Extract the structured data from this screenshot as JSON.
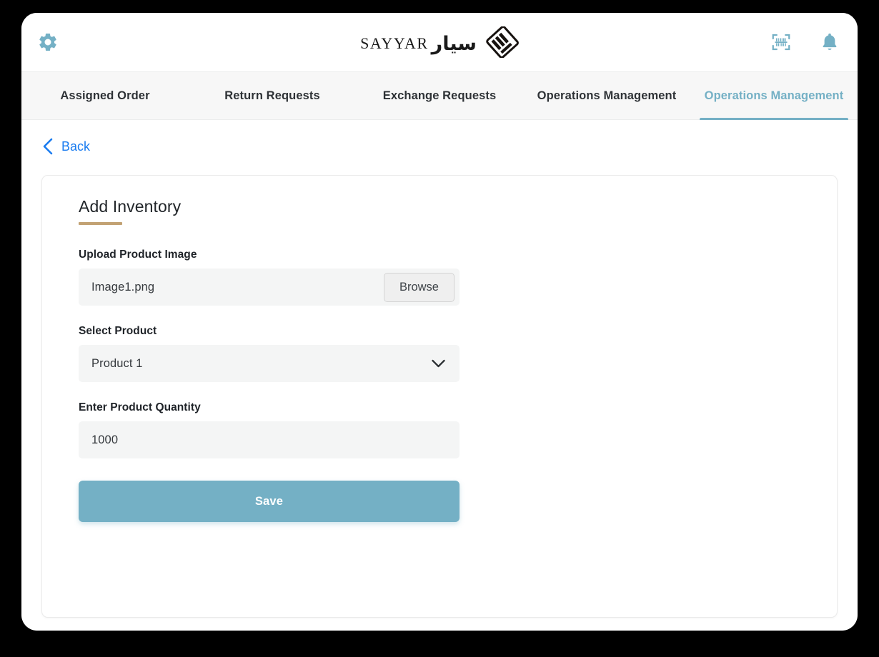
{
  "brand": {
    "latin_name": "SAYYAR",
    "arabic_name": "سيار",
    "logo_icon": "sayyar-diamond-logo"
  },
  "topbar": {
    "gear_icon": "gear-icon",
    "barcode_icon": "barcode-scanner-icon",
    "bell_icon": "notification-bell-icon",
    "accent_color": "#74b0c5"
  },
  "tabs": [
    {
      "label": "Assigned Order",
      "active": false
    },
    {
      "label": "Return Requests",
      "active": false
    },
    {
      "label": "Exchange Requests",
      "active": false
    },
    {
      "label": "Operations Management",
      "active": false
    },
    {
      "label": "Operations Management",
      "active": true
    }
  ],
  "back": {
    "label": "Back",
    "icon": "chevron-left-icon",
    "color": "#1a7cf0"
  },
  "card": {
    "title": "Add Inventory",
    "accent_color": "#c2a273"
  },
  "form": {
    "upload": {
      "label": "Upload Product Image",
      "value": "Image1.png",
      "browse_label": "Browse"
    },
    "product": {
      "label": "Select Product",
      "value": "Product 1",
      "chevron_icon": "chevron-down-icon"
    },
    "quantity": {
      "label": "Enter Product Quantity",
      "value": "1000"
    },
    "save_label": "Save",
    "save_color": "#74b0c5"
  }
}
